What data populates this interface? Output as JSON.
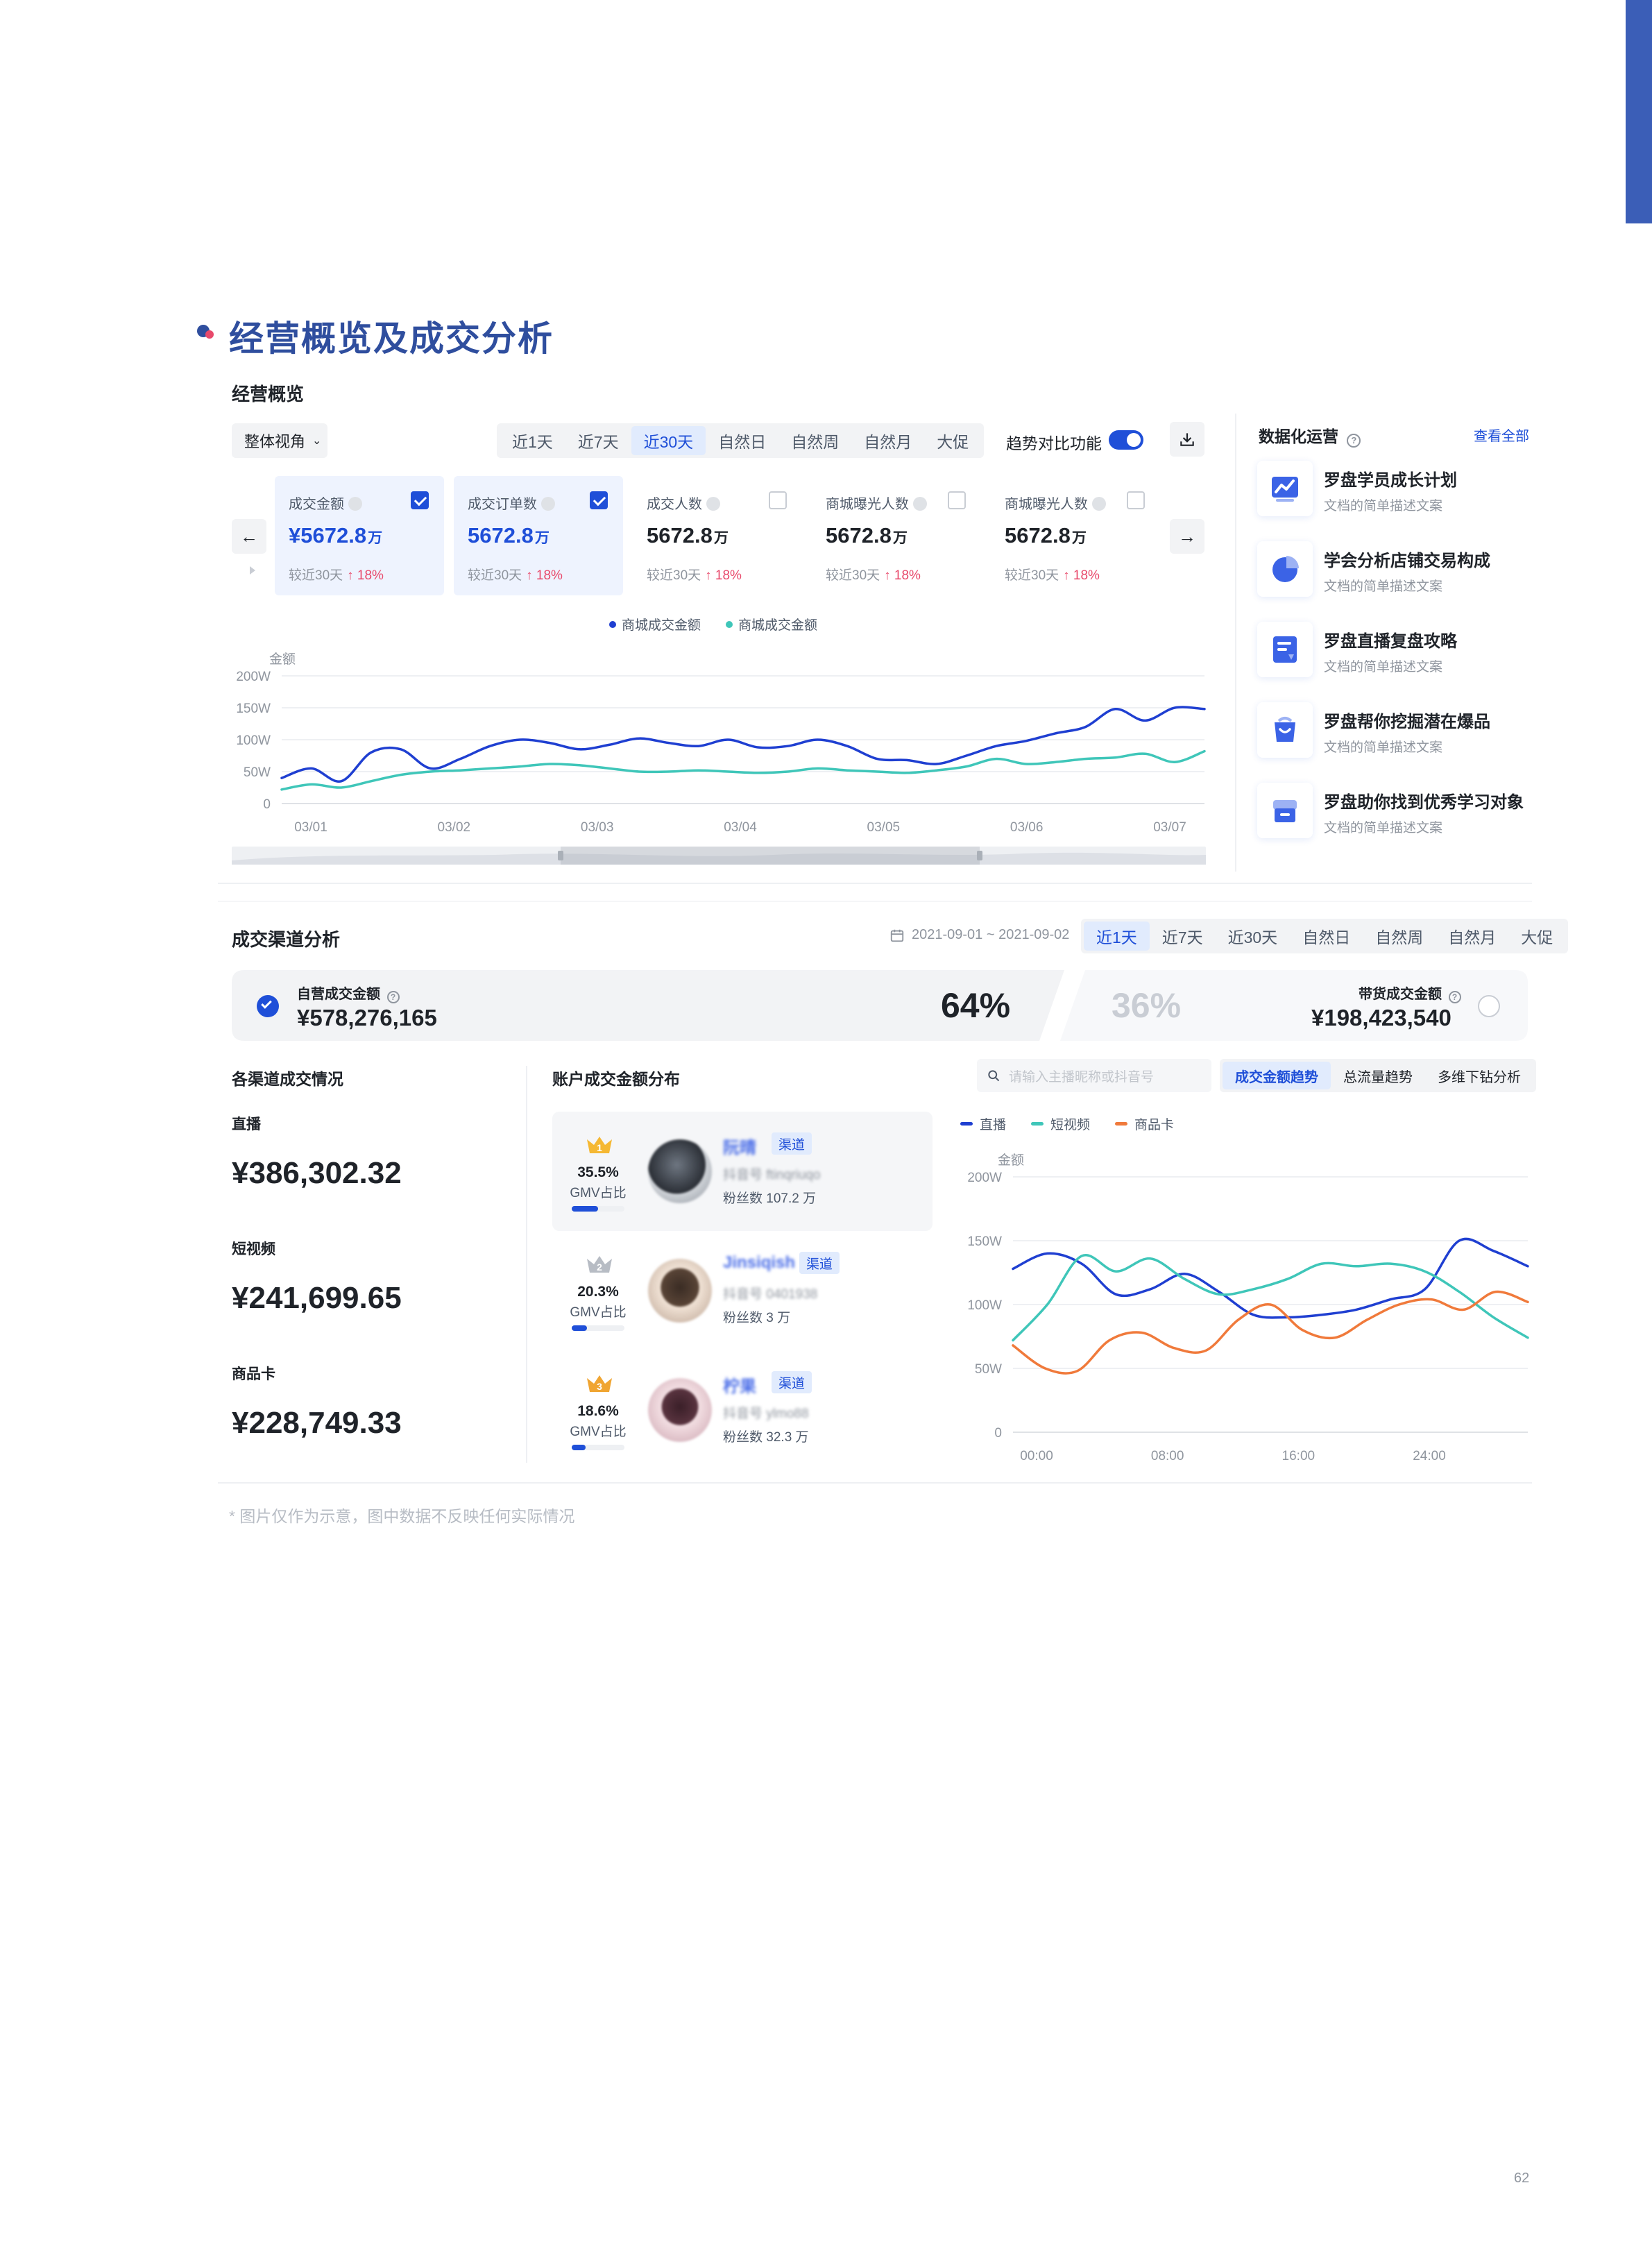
{
  "section_title": "经营概览及成交分析",
  "overview": {
    "title": "经营概览",
    "view_select": "整体视角",
    "time_tabs": [
      "近1天",
      "近7天",
      "近30天",
      "自然日",
      "自然周",
      "自然月",
      "大促"
    ],
    "active_time_tab": 2,
    "trend_compare_label": "趋势对比功能",
    "trend_compare_on": true,
    "metrics": [
      {
        "label": "成交金额",
        "value": "¥5672.8",
        "unit": "万",
        "compare": "较近30天",
        "delta": "18%",
        "selected": true
      },
      {
        "label": "成交订单数",
        "value": "5672.8",
        "unit": "万",
        "compare": "较近30天",
        "delta": "18%",
        "selected": true
      },
      {
        "label": "成交人数",
        "value": "5672.8",
        "unit": "万",
        "compare": "较近30天",
        "delta": "18%",
        "selected": false
      },
      {
        "label": "商城曝光人数",
        "value": "5672.8",
        "unit": "万",
        "compare": "较近30天",
        "delta": "18%",
        "selected": false
      },
      {
        "label": "商城曝光人数",
        "value": "5672.8",
        "unit": "万",
        "compare": "较近30天",
        "delta": "18%",
        "selected": false
      }
    ],
    "prev_arrow": "←",
    "next_arrow": "→"
  },
  "ops": {
    "title": "数据化运营",
    "view_all": "查看全部",
    "items": [
      {
        "title": "罗盘学员成长计划",
        "desc": "文档的简单描述文案",
        "icon": "growth-chart-icon"
      },
      {
        "title": "学会分析店铺交易构成",
        "desc": "文档的简单描述文案",
        "icon": "pie-chart-icon"
      },
      {
        "title": "罗盘直播复盘攻略",
        "desc": "文档的简单描述文案",
        "icon": "document-icon"
      },
      {
        "title": "罗盘帮你挖掘潜在爆品",
        "desc": "文档的简单描述文案",
        "icon": "shopping-bag-icon"
      },
      {
        "title": "罗盘助你找到优秀学习对象",
        "desc": "文档的简单描述文案",
        "icon": "store-icon"
      }
    ]
  },
  "channel": {
    "title": "成交渠道分析",
    "date_range": "2021-09-01 ~ 2021-09-02",
    "time_tabs": [
      "近1天",
      "近7天",
      "近30天",
      "自然日",
      "自然周",
      "自然月",
      "大促"
    ],
    "active_time_tab": 0,
    "self_label": "自营成交金额",
    "self_value": "¥578,276,165",
    "self_pct": "64%",
    "affiliate_pct": "36%",
    "affiliate_label": "带货成交金额",
    "affiliate_value": "¥198,423,540",
    "by_channel_title": "各渠道成交情况",
    "channels": [
      {
        "label": "直播",
        "value": "¥386,302.32"
      },
      {
        "label": "短视频",
        "value": "¥241,699.65"
      },
      {
        "label": "商品卡",
        "value": "¥228,749.33"
      }
    ],
    "account_title": "账户成交金额分布",
    "search_placeholder": "请输入主播昵称或抖音号",
    "view_tabs": [
      "成交金额趋势",
      "总流量趋势",
      "多维下钻分析"
    ],
    "active_view_tab": 0,
    "accounts": [
      {
        "rank": "1",
        "pct": "35.5%",
        "pct_label": "GMV占比",
        "share": 0.355,
        "name": "阮晴",
        "tag": "渠道",
        "account": "抖音号 ftinqriuqo",
        "fans": "粉丝数 107.2 万"
      },
      {
        "rank": "2",
        "pct": "20.3%",
        "pct_label": "GMV占比",
        "share": 0.203,
        "name": "Jinsiqish",
        "tag": "渠道",
        "account": "抖音号 0401938",
        "fans": "粉丝数 3 万"
      },
      {
        "rank": "3",
        "pct": "18.6%",
        "pct_label": "GMV占比",
        "share": 0.186,
        "name": "柠果",
        "tag": "渠道",
        "account": "抖音号 ylmo88",
        "fans": "粉丝数 32.3 万"
      }
    ]
  },
  "chart_data": [
    {
      "type": "line",
      "ylabel": "金额",
      "ylim": [
        0,
        200
      ],
      "yticks": [
        "0",
        "50W",
        "100W",
        "150W",
        "200W"
      ],
      "x": [
        "03/01",
        "03/02",
        "03/03",
        "03/04",
        "03/05",
        "03/06",
        "03/07"
      ],
      "legend": "top-center",
      "series": [
        {
          "name": "商城成交金额",
          "color": "#1f3fd1",
          "values": [
            40,
            55,
            35,
            80,
            85,
            55,
            70,
            90,
            100,
            95,
            85,
            92,
            102,
            95,
            90,
            100,
            88,
            90,
            100,
            90,
            70,
            68,
            62,
            75,
            90,
            98,
            110,
            120,
            148,
            130,
            150,
            148
          ]
        },
        {
          "name": "商城成交金额",
          "color": "#3fc6b9",
          "values": [
            22,
            30,
            25,
            35,
            45,
            50,
            52,
            55,
            58,
            62,
            60,
            55,
            50,
            50,
            52,
            50,
            48,
            50,
            55,
            52,
            50,
            48,
            52,
            58,
            70,
            62,
            65,
            70,
            72,
            78,
            65,
            82
          ]
        }
      ]
    },
    {
      "type": "line",
      "ylabel": "金额",
      "ylim": [
        0,
        200
      ],
      "yticks": [
        "0",
        "50W",
        "100W",
        "150W",
        "200W"
      ],
      "x": [
        "00:00",
        "08:00",
        "16:00",
        "24:00"
      ],
      "legend": "top-left",
      "series": [
        {
          "name": "直播",
          "color": "#1f3fd1",
          "values": [
            128,
            140,
            132,
            108,
            112,
            124,
            110,
            92,
            90,
            92,
            96,
            104,
            112,
            150,
            142,
            130
          ]
        },
        {
          "name": "短视频",
          "color": "#3fc6b9",
          "values": [
            72,
            100,
            138,
            126,
            136,
            120,
            108,
            112,
            120,
            132,
            130,
            132,
            126,
            110,
            90,
            74
          ]
        },
        {
          "name": "商品卡",
          "color": "#f07a3b",
          "values": [
            68,
            50,
            48,
            72,
            78,
            66,
            64,
            88,
            100,
            80,
            74,
            88,
            100,
            104,
            96,
            110,
            102
          ]
        }
      ]
    }
  ],
  "footnote": "* 图片仅作为示意，图中数据不反映任何实际情况",
  "page_number": "62"
}
